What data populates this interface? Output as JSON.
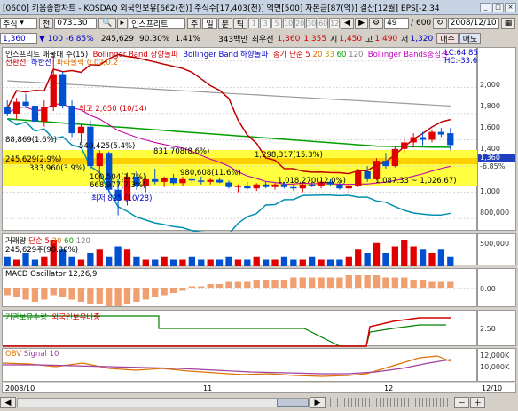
{
  "title_bar": {
    "text": "[0600] 키움종합차트 - KOSDAQ 외국인보유[662(천)] 주식수[17,403(천)] 액면[500] 자본금[87(억)] 결산[12월] EPS[-2,34"
  },
  "toolbar1": {
    "market": "주식",
    "code_prefix": "전",
    "code": "073130",
    "stock_name": "인스프리트",
    "btn_ju": "주",
    "btn_il": "일",
    "btn_bun": "분",
    "btn_tick": "틱",
    "periods": [
      "1",
      "3",
      "5",
      "10",
      "20",
      "30",
      "60",
      "12"
    ],
    "count": "49",
    "total": "/ 600",
    "date": "2008/12/10"
  },
  "toolbar2": {
    "price": "1,360",
    "change": "▼ 100",
    "change_pct": "-6.85%",
    "volume": "245,629",
    "vol_ratio": "90.30%",
    "turnover": "1.41%",
    "amount": "343백만",
    "low_label": "최우선",
    "ask": "1,360",
    "bid": "1,355",
    "open_label": "시",
    "open": "1,450",
    "high_label": "고",
    "high": "1,490",
    "low2_label": "저",
    "low2": "1,320",
    "buy_btn": "매수",
    "sell_btn": "매도"
  },
  "price_panel": {
    "legend_row1": [
      {
        "text": "인스프리트 매물대 수(15)",
        "color": "#000000"
      },
      {
        "text": "Bollinger Band 상향돌파",
        "color": "#c00000"
      },
      {
        "text": "Bollinger Band 하향돌파",
        "color": "#0000c0"
      },
      {
        "text": "종가 단순 5",
        "color": "#c00000"
      },
      {
        "text": "20",
        "color": "#e07000"
      },
      {
        "text": "33",
        "color": "#c0a000"
      },
      {
        "text": "60",
        "color": "#00a000"
      },
      {
        "text": "120",
        "color": "#808080"
      },
      {
        "text": "Bollinger Bands중심선",
        "color": "#c000c0"
      },
      {
        "text": "LC:64.85",
        "color": "#0000c0"
      }
    ],
    "legend_row2": [
      {
        "text": "전환선",
        "color": "#c00000"
      },
      {
        "text": "하한선",
        "color": "#0000c0"
      },
      {
        "text": "파라볼릭 0.02,0.2",
        "color": "#e07000"
      }
    ],
    "hc_label": "HC:-33.66",
    "annotations": [
      {
        "text": "최고 2,050 (10/14)",
        "color": "#c00000"
      },
      {
        "text": "88,869(1.6%)",
        "color": "#000000"
      },
      {
        "text": "540,425(5.4%)",
        "color": "#000000"
      },
      {
        "text": "831,708(8.6%)",
        "color": "#000000"
      },
      {
        "text": "1,298,317(15.3%)",
        "color": "#000000"
      },
      {
        "text": "245,629(2.9%)",
        "color": "#000000"
      },
      {
        "text": "333,960(3.9%)",
        "color": "#000000"
      },
      {
        "text": "100,504(1.7%)",
        "color": "#000000"
      },
      {
        "text": "980,608(11.6%)",
        "color": "#000000"
      },
      {
        "text": "668,977(7.3%)",
        "color": "#000000"
      },
      {
        "text": "1,018,270(12.0%)",
        "color": "#000000"
      },
      {
        "text": "1,087.33 ~ 1,026.67)",
        "color": "#000000"
      },
      {
        "text": "최저 825 (10/28)",
        "color": "#0000c0"
      }
    ],
    "axis_ticks": [
      "2,000",
      "1,800",
      "1,600",
      "1,400",
      "1,200",
      "1,000",
      "800,000"
    ],
    "current_price": "1,360",
    "current_pct": "-6.85%"
  },
  "volume_panel": {
    "legend": [
      {
        "text": "거래량",
        "color": "#000000"
      },
      {
        "text": "단순 5",
        "color": "#c00000"
      },
      {
        "text": "20",
        "color": "#e07000"
      },
      {
        "text": "60",
        "color": "#00a000"
      },
      {
        "text": "120",
        "color": "#808080"
      }
    ],
    "value_label": "245,629주(90.30%)",
    "axis_ticks": [
      "500,000"
    ]
  },
  "macd_panel": {
    "legend": "MACD Oscillator 12,26,9",
    "axis_ticks": [
      "0.00"
    ]
  },
  "foreign_panel": {
    "legend_a": "기관보유수량",
    "legend_b": "외국인보유비중",
    "axis_ticks": [
      "2.50"
    ]
  },
  "obv_panel": {
    "legend_a": "OBV",
    "legend_b": "Signal 10",
    "axis_ticks": [
      "12,000K",
      "10,000K"
    ]
  },
  "date_axis": {
    "labels": [
      "2008/10",
      "11",
      "12",
      "12/10"
    ]
  },
  "chart_data": {
    "type": "candlestick",
    "ylim": [
      700,
      2100
    ],
    "candles": [
      {
        "o": 1650,
        "h": 1700,
        "l": 1580,
        "c": 1600
      },
      {
        "o": 1600,
        "h": 1720,
        "l": 1560,
        "c": 1690
      },
      {
        "o": 1690,
        "h": 1750,
        "l": 1640,
        "c": 1660
      },
      {
        "o": 1660,
        "h": 1720,
        "l": 1520,
        "c": 1540
      },
      {
        "o": 1540,
        "h": 1700,
        "l": 1500,
        "c": 1650
      },
      {
        "o": 1650,
        "h": 2050,
        "l": 1620,
        "c": 1900
      },
      {
        "o": 1900,
        "h": 1920,
        "l": 1640,
        "c": 1660
      },
      {
        "o": 1660,
        "h": 1700,
        "l": 1420,
        "c": 1450
      },
      {
        "o": 1450,
        "h": 1520,
        "l": 1380,
        "c": 1500
      },
      {
        "o": 1500,
        "h": 1550,
        "l": 1180,
        "c": 1200
      },
      {
        "o": 1200,
        "h": 1320,
        "l": 1080,
        "c": 1300
      },
      {
        "o": 1300,
        "h": 1310,
        "l": 1000,
        "c": 1020
      },
      {
        "o": 1020,
        "h": 1100,
        "l": 825,
        "c": 940
      },
      {
        "o": 940,
        "h": 1150,
        "l": 900,
        "c": 1120
      },
      {
        "o": 1120,
        "h": 1160,
        "l": 1020,
        "c": 1050
      },
      {
        "o": 1050,
        "h": 1130,
        "l": 1000,
        "c": 1100
      },
      {
        "o": 1100,
        "h": 1180,
        "l": 1060,
        "c": 1080
      },
      {
        "o": 1080,
        "h": 1120,
        "l": 1040,
        "c": 1110
      },
      {
        "o": 1110,
        "h": 1140,
        "l": 1060,
        "c": 1070
      },
      {
        "o": 1070,
        "h": 1120,
        "l": 1050,
        "c": 1100
      },
      {
        "o": 1100,
        "h": 1130,
        "l": 1070,
        "c": 1090
      },
      {
        "o": 1090,
        "h": 1120,
        "l": 1060,
        "c": 1080
      },
      {
        "o": 1080,
        "h": 1110,
        "l": 1060,
        "c": 1095
      },
      {
        "o": 1095,
        "h": 1110,
        "l": 1070,
        "c": 1075
      },
      {
        "o": 1075,
        "h": 1090,
        "l": 1030,
        "c": 1040
      },
      {
        "o": 1040,
        "h": 1060,
        "l": 1000,
        "c": 1050
      },
      {
        "o": 1050,
        "h": 1080,
        "l": 1020,
        "c": 1030
      },
      {
        "o": 1030,
        "h": 1070,
        "l": 1010,
        "c": 1060
      },
      {
        "o": 1060,
        "h": 1080,
        "l": 1030,
        "c": 1040
      },
      {
        "o": 1040,
        "h": 1070,
        "l": 1020,
        "c": 1060
      },
      {
        "o": 1060,
        "h": 1080,
        "l": 1030,
        "c": 1040
      },
      {
        "o": 1040,
        "h": 1060,
        "l": 1010,
        "c": 1030
      },
      {
        "o": 1030,
        "h": 1070,
        "l": 1000,
        "c": 1060
      },
      {
        "o": 1060,
        "h": 1080,
        "l": 1040,
        "c": 1050
      },
      {
        "o": 1050,
        "h": 1090,
        "l": 1030,
        "c": 1080
      },
      {
        "o": 1080,
        "h": 1100,
        "l": 1050,
        "c": 1060
      },
      {
        "o": 1060,
        "h": 1080,
        "l": 1020,
        "c": 1030
      },
      {
        "o": 1030,
        "h": 1060,
        "l": 1000,
        "c": 1050
      },
      {
        "o": 1050,
        "h": 1180,
        "l": 1040,
        "c": 1160
      },
      {
        "o": 1160,
        "h": 1200,
        "l": 1080,
        "c": 1100
      },
      {
        "o": 1100,
        "h": 1260,
        "l": 1090,
        "c": 1240
      },
      {
        "o": 1240,
        "h": 1300,
        "l": 1180,
        "c": 1200
      },
      {
        "o": 1200,
        "h": 1350,
        "l": 1190,
        "c": 1330
      },
      {
        "o": 1330,
        "h": 1420,
        "l": 1300,
        "c": 1380
      },
      {
        "o": 1380,
        "h": 1450,
        "l": 1340,
        "c": 1420
      },
      {
        "o": 1420,
        "h": 1460,
        "l": 1350,
        "c": 1400
      },
      {
        "o": 1400,
        "h": 1480,
        "l": 1380,
        "c": 1460
      },
      {
        "o": 1460,
        "h": 1490,
        "l": 1420,
        "c": 1440
      },
      {
        "o": 1450,
        "h": 1490,
        "l": 1320,
        "c": 1360
      }
    ],
    "volume": [
      3,
      2,
      4,
      2,
      3,
      8,
      5,
      3,
      2,
      4,
      5,
      3,
      6,
      5,
      3,
      2,
      2,
      3,
      2,
      2,
      3,
      2,
      2,
      2,
      3,
      2,
      2,
      3,
      2,
      2,
      3,
      2,
      2,
      3,
      2,
      2,
      2,
      3,
      5,
      4,
      7,
      4,
      6,
      8,
      6,
      5,
      4,
      5,
      3
    ],
    "macd": [
      -3,
      -4,
      -5,
      -6,
      -5,
      -3,
      -4,
      -5,
      -6,
      -7,
      -7,
      -8,
      -8,
      -7,
      -6,
      -5,
      -4,
      -3,
      -2,
      -1,
      1,
      1,
      2,
      2,
      3,
      3,
      3,
      4,
      4,
      4,
      4,
      5,
      5,
      5,
      5,
      5,
      5,
      6,
      6,
      6,
      6,
      5,
      5,
      5,
      4,
      4,
      3,
      3,
      3
    ]
  }
}
